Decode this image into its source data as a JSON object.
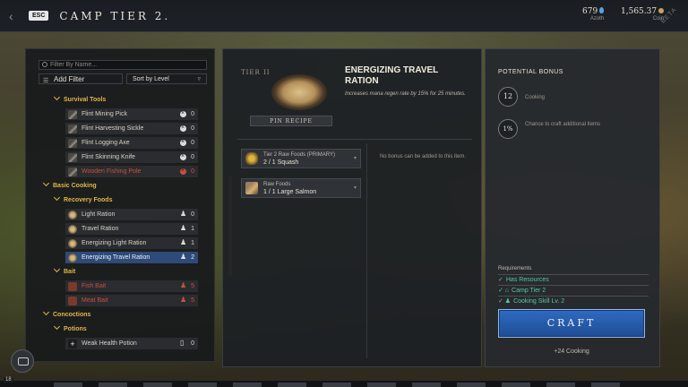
{
  "header": {
    "esc_label": "ESC",
    "title": "CAMP TIER 2.",
    "azoth_value": "679",
    "azoth_label": "Azoth",
    "coin_value": "1,565.37",
    "coin_label": "Coin",
    "watermark": "BETA"
  },
  "sidebar": {
    "filter_placeholder": "Filter By Name...",
    "add_filter_label": "Add Filter",
    "sort_label": "Sort by Level",
    "tree": [
      {
        "kind": "subcat",
        "label": "Survival Tools"
      },
      {
        "kind": "item",
        "label": "Flint Mining Pick",
        "status": "x",
        "count": "0"
      },
      {
        "kind": "item",
        "label": "Flint Harvesting Sickle",
        "status": "x",
        "count": "0"
      },
      {
        "kind": "item",
        "label": "Flint Logging Axe",
        "status": "x",
        "count": "0"
      },
      {
        "kind": "item",
        "label": "Flint Skinning Knife",
        "status": "x",
        "count": "0"
      },
      {
        "kind": "item",
        "label": "Wooden Fishing Pole",
        "status": "xr",
        "count": "0"
      },
      {
        "kind": "cat",
        "label": "Basic Cooking"
      },
      {
        "kind": "subcat",
        "label": "Recovery Foods"
      },
      {
        "kind": "item",
        "label": "Light Ration",
        "status": "cup",
        "count": "0"
      },
      {
        "kind": "item",
        "label": "Travel Ration",
        "status": "cup",
        "count": "1"
      },
      {
        "kind": "item",
        "label": "Energizing Light Ration",
        "status": "cup",
        "count": "1"
      },
      {
        "kind": "item",
        "label": "Energizing Travel Ration",
        "status": "cup",
        "count": "2",
        "selected": true
      },
      {
        "kind": "subcat",
        "label": "Bait"
      },
      {
        "kind": "item",
        "label": "Fish Bait",
        "status": "cupr",
        "count": "5"
      },
      {
        "kind": "item",
        "label": "Meat Bait",
        "status": "cupr",
        "count": "5"
      },
      {
        "kind": "cat",
        "label": "Concoctions"
      },
      {
        "kind": "subcat",
        "label": "Potions"
      },
      {
        "kind": "item",
        "label": "Weak Health Potion",
        "status": "book",
        "count": "0"
      }
    ]
  },
  "recipe": {
    "tier_label": "TIER II",
    "pin_label": "PIN RECIPE",
    "title": "ENERGIZING TRAVEL RATION",
    "description": "Increases mana regen rate by 15% for 25 minutes.",
    "ingredients": [
      {
        "name": "Tier 2 Raw Foods (PRIMARY)",
        "qty": "2 / 1 Squash"
      },
      {
        "name": "Raw Foods",
        "qty": "1 / 1 Large Salmon"
      }
    ],
    "no_bonus_text": "No bonus can be added to this item."
  },
  "bonus": {
    "title": "POTENTIAL BONUS",
    "skill_value": "12",
    "skill_label": "Cooking",
    "chance_value": "1%",
    "chance_label": "Chance to craft additional items"
  },
  "requirements": {
    "title": "Requirements",
    "items": [
      "Has Resources",
      "Camp Tier 2",
      "Cooking Skill Lv. 2"
    ]
  },
  "craft": {
    "button_label": "CRAFT",
    "xp_gain": "+24 Cooking"
  },
  "footer": {
    "level": "18"
  }
}
